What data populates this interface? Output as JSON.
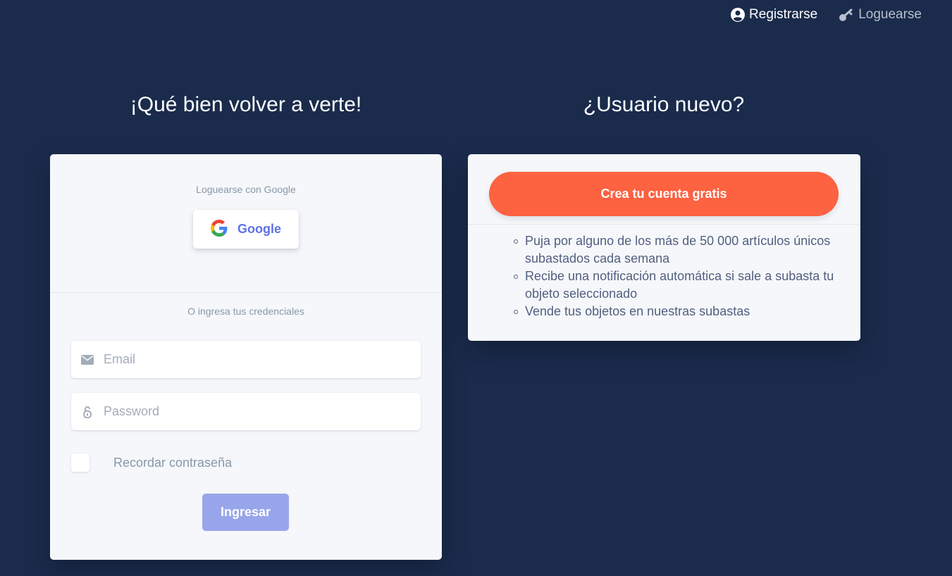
{
  "nav": {
    "register_label": "Registrarse",
    "login_label": "Loguearse"
  },
  "login_panel": {
    "heading": "¡Qué bien volver a verte!",
    "google_caption": "Loguearse con Google",
    "google_button": "Google",
    "credentials_caption": "O ingresa tus credenciales",
    "email_placeholder": "Email",
    "password_placeholder": "Password",
    "remember_label": "Recordar contraseña",
    "submit_label": "Ingresar"
  },
  "signup_panel": {
    "heading": "¿Usuario nuevo?",
    "cta_label": "Crea tu cuenta gratis",
    "benefits": [
      "Puja por alguno de los más de 50 000 artículos únicos subastados cada semana",
      "Recibe una notificación automática si sale a subasta tu objeto seleccionado",
      "Vende tus objetos en nuestras subastas"
    ]
  },
  "colors": {
    "background": "#1a2b4c",
    "card": "#f5f7fa",
    "cta": "#fd6241",
    "submit": "#98a5ea",
    "google_text": "#5e72e4"
  },
  "icons": {
    "register": "user-circle-icon",
    "login": "key-icon",
    "google": "google-logo-icon",
    "email": "envelope-icon",
    "password": "lock-open-icon"
  }
}
